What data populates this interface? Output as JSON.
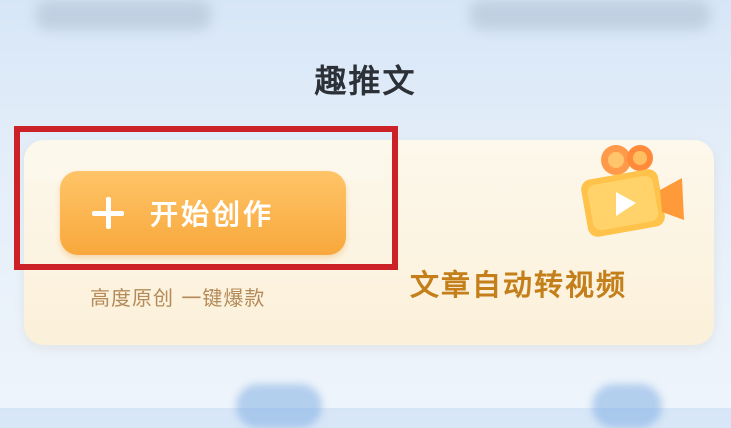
{
  "page": {
    "title": "趣推文"
  },
  "card": {
    "start_button_label": "开始创作",
    "subtitle": "高度原创 一键爆款",
    "headline": "文章自动转视频"
  },
  "icons": {
    "start_button_icon": "plus-icon",
    "card_illustration": "movie-camera-icon"
  },
  "colors": {
    "accent": "#f8a83c",
    "headline": "#c47f1a",
    "highlight_border": "#cb2127"
  }
}
